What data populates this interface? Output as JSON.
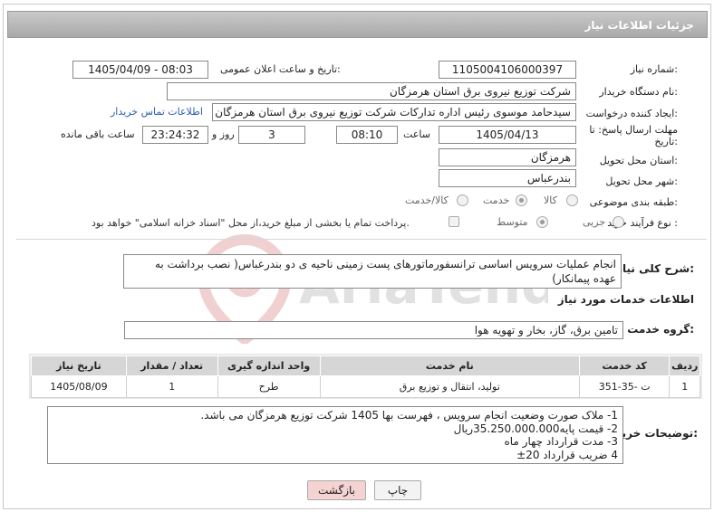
{
  "header": {
    "title": "جزئیات اطلاعات نیاز"
  },
  "fields": {
    "need_number_label": "شماره نیاز:",
    "need_number": "1105004106000397",
    "announce_label": "تاریخ و ساعت اعلان عمومی:",
    "announce_value": "1405/04/09 - 08:03",
    "buyer_label": "نام دستگاه خریدار:",
    "buyer_value": "شرکت توزیع نیروی برق استان هرمزگان",
    "creator_label": "ایجاد کننده درخواست:",
    "creator_value": "سیدحامد موسوی رئیس اداره تدارکات شرکت توزیع نیروی برق استان هرمزگان",
    "contact_link": "اطلاعات تماس خریدار",
    "deadline_label_1": "مهلت ارسال پاسخ: تا",
    "deadline_label_2": "تاریخ:",
    "deadline_date": "1405/04/13",
    "time_label": "ساعت",
    "deadline_time": "08:10",
    "days_value": "3",
    "days_label": "روز و",
    "remaining_time": "23:24:32",
    "remaining_label": "ساعت باقی مانده",
    "province_label": "استان محل تحویل:",
    "province_value": "هرمزگان",
    "city_label": "شهر محل تحویل:",
    "city_value": "بندرعباس",
    "category_label": "طبقه بندی موضوعی:",
    "category_options": [
      "کالا",
      "خدمت",
      "کالا/خدمت"
    ],
    "category_selected": "خدمت",
    "process_label": "نوع فرآیند خرید :",
    "process_options": [
      "جزیی",
      "متوسط"
    ],
    "process_selected": "متوسط",
    "payment_note": "پرداخت تمام یا بخشی از مبلغ خرید،از محل \"اسناد خزانه اسلامی\" خواهد بود."
  },
  "summary": {
    "label": "شرح کلی نیاز:",
    "text": "انجام عملیات سرویس اساسی ترانسفورماتورهای پست زمینی ناحیه ی دو بندرعباس( نصب برداشت به عهده پیمانکار)"
  },
  "services": {
    "section_title": "اطلاعات خدمات مورد نیاز",
    "group_label": "گروه خدمت:",
    "group_value": "تامین برق، گاز، بخار و تهویه هوا",
    "columns": [
      "ردیف",
      "کد خدمت",
      "نام خدمت",
      "واحد اندازه گیری",
      "تعداد / مقدار",
      "تاریخ نیاز"
    ],
    "rows": [
      [
        "1",
        "ت -35-351",
        "تولید، انتقال و توزیع برق",
        "طرح",
        "1",
        "1405/08/09"
      ]
    ]
  },
  "notes": {
    "label": "توضیحات خریدار:",
    "lines": [
      "1- ملاک صورت وضعیت انجام سرویس ، فهرست بها 1405   شرکت توزیع هرمزگان می باشد.",
      "2- قیمت پایه35.250.000.000ریال",
      "3- مدت قرارداد چهار ماه",
      "4 ضریب قرارداد 20±"
    ]
  },
  "buttons": {
    "print": "چاپ",
    "back": "بازگشت"
  },
  "watermark": "AriaTender.net",
  "colors": {
    "link": "#2a5db0",
    "header_bg": "#b5b5b5",
    "back_button_bg": "#f6d3d3"
  }
}
